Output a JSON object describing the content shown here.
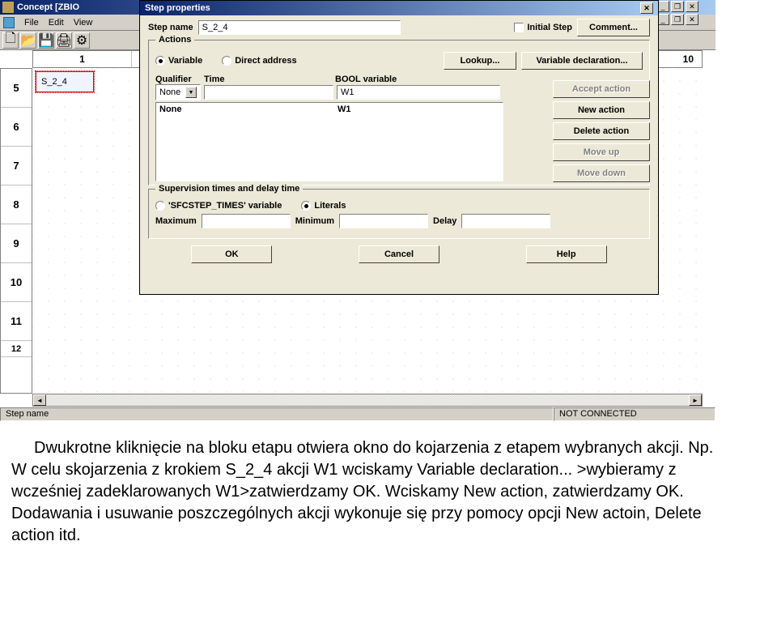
{
  "window": {
    "title": "Concept [ZBIO",
    "menu": {
      "file": "File",
      "edit": "Edit",
      "view": "View"
    }
  },
  "child_controls": {
    "min": "_",
    "max": "❐",
    "close": "✕"
  },
  "editor": {
    "ruler_h": {
      "c1": "1",
      "cR": "10"
    },
    "ruler_v": [
      "5",
      "6",
      "7",
      "8",
      "9",
      "10",
      "11",
      "12"
    ],
    "step_label": "S_2_4",
    "status_left": "Step name",
    "status_right": "NOT CONNECTED"
  },
  "dialog": {
    "title": "Step properties",
    "step_name_label": "Step name",
    "step_name_value": "S_2_4",
    "initial_step": "Initial Step",
    "comment_btn": "Comment...",
    "actions": {
      "groupLabel": "Actions",
      "radio_variable": "Variable",
      "radio_direct": "Direct address",
      "lookup_btn": "Lookup...",
      "vardecl_btn": "Variable declaration...",
      "hdr_qual": "Qualifier",
      "hdr_time": "Time",
      "hdr_bool": "BOOL variable",
      "qualifier_value": "None",
      "time_value": "",
      "bool_value": "W1",
      "list_qual": "None",
      "list_bool": "W1"
    },
    "side": {
      "accept": "Accept action",
      "newact": "New action",
      "delete": "Delete action",
      "moveup": "Move up",
      "movedown": "Move down"
    },
    "sup": {
      "groupLabel": "Supervision times and delay time",
      "radio_var": "'SFCSTEP_TIMES' variable",
      "radio_lit": "Literals",
      "max_label": "Maximum",
      "min_label": "Minimum",
      "delay_label": "Delay"
    },
    "bottom": {
      "ok": "OK",
      "cancel": "Cancel",
      "help": "Help"
    }
  },
  "description": {
    "p1": "Dwukrotne kliknięcie na bloku etapu otwiera okno do kojarzenia z etapem wybranych akcji. Np. W celu skojarzenia z krokiem S_2_4 akcji W1 wciskamy Variable declaration... >wybieramy z wcześniej zadeklarowanych W1>zatwierdzamy OK. Wciskamy New action, zatwierdzamy OK. Dodawania i usuwanie poszczególnych akcji wykonuje się przy pomocy opcji New actoin, Delete action itd."
  }
}
